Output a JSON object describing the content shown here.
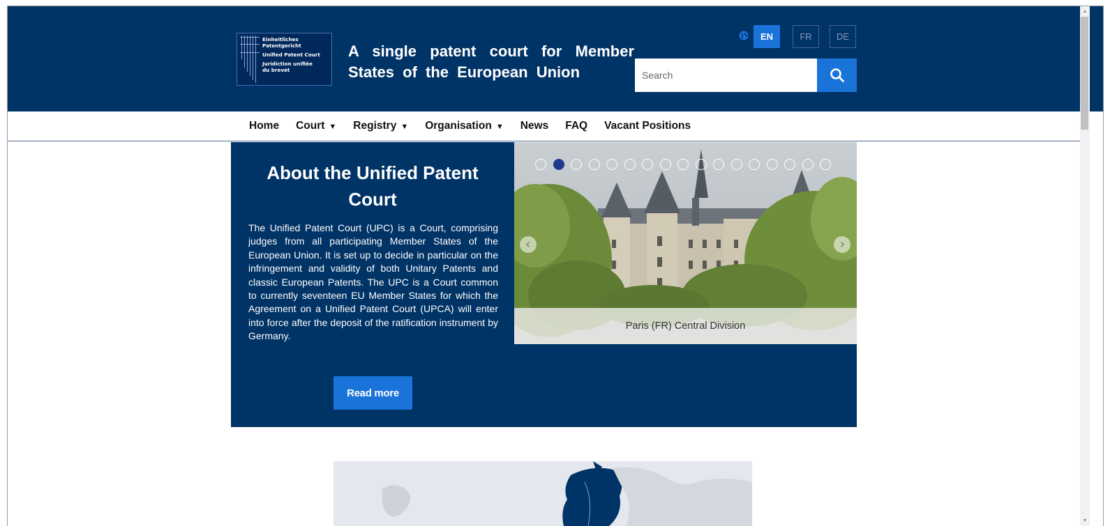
{
  "header": {
    "logo_lines": [
      "Einheitliches",
      "Patentgericht",
      "Unified Patent Court",
      "Juridiction unifiée",
      "du brevet"
    ],
    "tagline": "A single patent court for Member States of the European Union",
    "languages": [
      {
        "code": "EN",
        "active": true
      },
      {
        "code": "FR",
        "active": false
      },
      {
        "code": "DE",
        "active": false
      }
    ],
    "search": {
      "placeholder": "Search"
    }
  },
  "nav": {
    "items": [
      {
        "label": "Home",
        "dropdown": false
      },
      {
        "label": "Court",
        "dropdown": true
      },
      {
        "label": "Registry",
        "dropdown": true
      },
      {
        "label": "Organisation",
        "dropdown": true
      },
      {
        "label": "News",
        "dropdown": false
      },
      {
        "label": "FAQ",
        "dropdown": false
      },
      {
        "label": "Vacant Positions",
        "dropdown": false
      }
    ],
    "caret": "▼"
  },
  "hero": {
    "title": "About the Unified Patent Court",
    "body": "The Unified Patent Court (UPC) is a Court, comprising judges from all participating Member States of the European Union. It is set up to decide in particular on the infringement and validity of both Unitary Patents and classic European Patents. The UPC is a Court common to currently seventeen EU Member States for which the Agreement on a Unified Patent Court (UPCA) will enter into force after the deposit of the ratification instrument by Germany.",
    "read_more": "Read more"
  },
  "slider": {
    "caption": "Paris (FR) Central Division",
    "slide_count": 17,
    "active_index": 1,
    "prev_icon": "chevron-left",
    "next_icon": "chevron-right"
  },
  "colors": {
    "navy": "#003366",
    "accent": "#1a73d9",
    "dot_active": "#1e3b8a"
  }
}
